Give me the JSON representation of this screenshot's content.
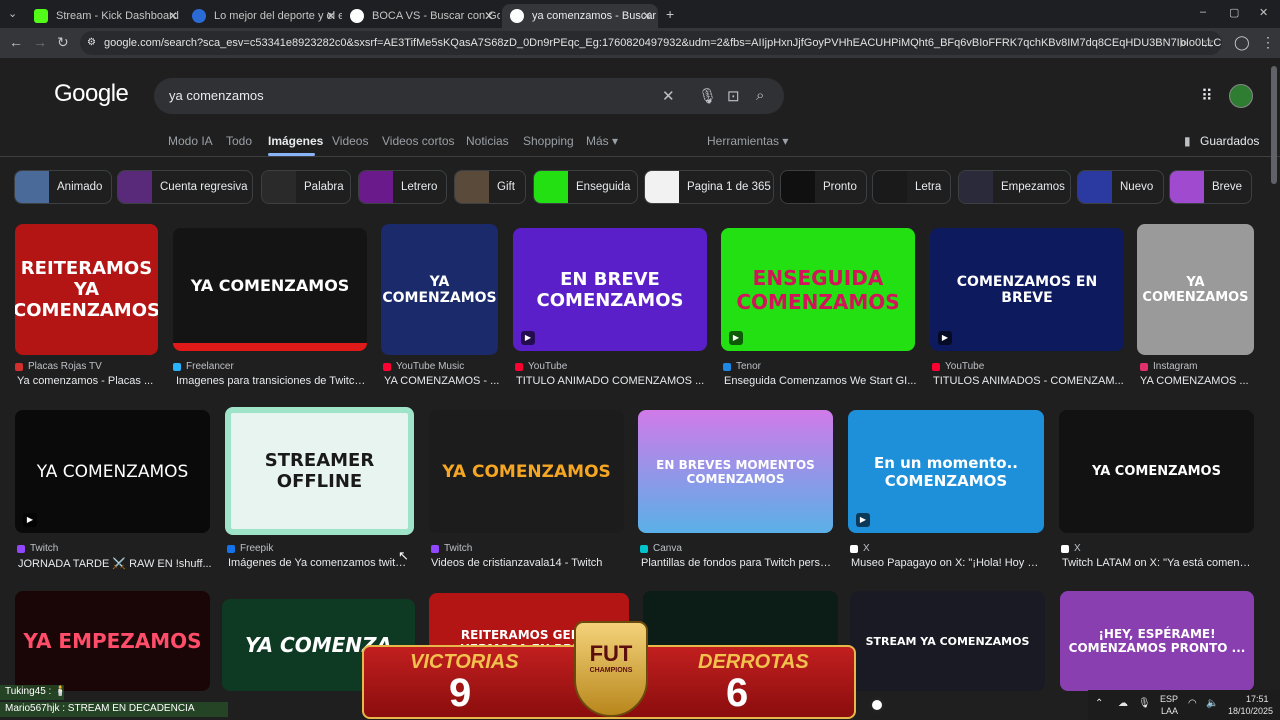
{
  "tabs": [
    {
      "title": "Stream - Kick Dashboard",
      "favicon_color": "#53fc18"
    },
    {
      "title": "Lo mejor del deporte y el entre",
      "favicon_color": "#2b6bd6"
    },
    {
      "title": "BOCA VS - Buscar con Google",
      "favicon_color": "#ffffff"
    },
    {
      "title": "ya comenzamos - Buscar con G",
      "favicon_color": "#ffffff"
    }
  ],
  "address_bar": {
    "url": "google.com/search?sca_esv=c53341e8923282c0&sxsrf=AE3TifMe5sKQasA7S68zD_0Dn9rPEqc_Eg:1760820497932&udm=2&fbs=AIIjpHxnJjfGoyPVHhEACUHPiMQht6_BFq6vBIoFFRK7qchKBv8IM7dq8CEqHDU3BN7IbIo0LLC9Cn6mkAPuJ2pf_5AB2jIEfeNRohPjG..."
  },
  "search": {
    "logo": "Google",
    "query": "ya comenzamos"
  },
  "nav": {
    "tabs": [
      "Modo IA",
      "Todo",
      "Imágenes",
      "Videos",
      "Videos cortos",
      "Noticias",
      "Shopping",
      "Más ▾"
    ],
    "active": "Imágenes",
    "tools": "Herramientas ▾",
    "saved": "Guardados"
  },
  "chips": [
    "Animado",
    "Cuenta regresiva",
    "Palabra",
    "Letrero",
    "Gift",
    "Enseguida",
    "Pagina 1 de 365",
    "Pronto",
    "Letra",
    "Empezamos",
    "Nuevo",
    "Breve"
  ],
  "row1": [
    {
      "img_text": "REITERAMOS YA COMENZAMOS",
      "source": "Placas Rojas TV",
      "caption": "Ya comenzamos - Placas ...",
      "bg": "#b31414",
      "fg": "#ffffff",
      "src_color": "#d32f2f"
    },
    {
      "img_text": "YA COMENZAMOS",
      "source": "Freelancer",
      "caption": "Imagenes para transiciones de Twitch ...",
      "bg": "#141414",
      "fg": "#ffffff",
      "src_color": "#29b2fe"
    },
    {
      "img_text": "YA COMENZAMOS",
      "source": "YouTube Music",
      "caption": "YA COMENZAMOS - ...",
      "bg": "#1a2a6b",
      "fg": "#ffffff",
      "src_color": "#ff0033"
    },
    {
      "img_text": "EN BREVE COMENZAMOS",
      "source": "YouTube",
      "caption": "TITULO ANIMADO COMENZAMOS ...",
      "bg": "#5a1fc9",
      "fg": "#ffffff",
      "src_color": "#ff0033"
    },
    {
      "img_text": "ENSEGUIDA COMENZAMOS",
      "source": "Tenor",
      "caption": "Enseguida Comenzamos We Start GI...",
      "bg": "#22e012",
      "fg": "#d4145a",
      "src_color": "#1e88e5"
    },
    {
      "img_text": "COMENZAMOS EN BREVE",
      "source": "YouTube",
      "caption": "TITULOS ANIMADOS - COMENZAM...",
      "bg": "#0d1a5e",
      "fg": "#ffffff",
      "src_color": "#ff0033"
    },
    {
      "img_text": "YA COMENZAMOS",
      "source": "Instagram",
      "caption": "YA COMENZAMOS ...",
      "bg": "#9a9a9a",
      "fg": "#ffffff",
      "src_color": "#e1306c"
    }
  ],
  "row2": [
    {
      "img_text": "YA COMENZAMOS",
      "source": "Twitch",
      "caption": "JORNADA TARDE ⚔️ RAW EN !shuff...",
      "bg": "#0a0a0a",
      "fg": "#ffffff",
      "src_color": "#9146ff"
    },
    {
      "img_text": "STREAMER OFFLINE",
      "source": "Freepik",
      "caption": "Imágenes de Ya comenzamos twitch ...",
      "bg": "#e8f4f0",
      "fg": "#1a1a1a",
      "src_color": "#1273eb"
    },
    {
      "img_text": "YA COMENZAMOS",
      "source": "Twitch",
      "caption": "Videos de cristianzavala14 - Twitch",
      "bg": "#1c1c1c",
      "fg": "#f5a623",
      "src_color": "#9146ff"
    },
    {
      "img_text": "EN BREVES MOMENTOS COMENZAMOS",
      "source": "Canva",
      "caption": "Plantillas de fondos para Twitch perso...",
      "bg": "#b85ed6",
      "fg": "#ffffff",
      "src_color": "#00c4cc"
    },
    {
      "img_text": "En un momento.. COMENZAMOS",
      "source": "X",
      "caption": "Museo Papagayo on X: \"¡Hola! Hoy e...",
      "bg": "#1e8fd9",
      "fg": "#ffffff",
      "src_color": "#ffffff"
    },
    {
      "img_text": "YA COMENZAMOS",
      "source": "X",
      "caption": "Twitch LATAM on X: \"Ya está comenz...",
      "bg": "#121212",
      "fg": "#ffffff",
      "src_color": "#ffffff"
    }
  ],
  "row3": [
    {
      "img_text": "YA EMPEZAMOS",
      "bg": "#1a0606",
      "fg": "#ff4d6a"
    },
    {
      "img_text": "YA COMENZA",
      "bg": "#0e3a24",
      "fg": "#ffffff"
    },
    {
      "img_text": "REITERAMOS GENTE HERMOSA EN BREVE",
      "bg": "#b31414",
      "fg": "#ffffff"
    },
    {
      "img_text": "",
      "bg": "#0c1c16",
      "fg": "#ffffff"
    },
    {
      "img_text": "STREAM YA COMENZAMOS",
      "bg": "#1a1a24",
      "fg": "#ffffff"
    },
    {
      "img_text": "¡HEY, ESPÉRAME! COMENZAMOS PRONTO ...",
      "bg": "#8a3fb0",
      "fg": "#ffffff"
    }
  ],
  "overlay": {
    "left_label": "VICTORIAS",
    "left_value": "9",
    "right_label": "DERROTAS",
    "right_value": "6",
    "badge": "FUT",
    "badge_sub": "CHAMPIONS"
  },
  "chat": [
    "Tuking45 : 🕯️",
    "Mario567hjk : STREAM EN DECADENCIA"
  ],
  "tray": {
    "lang": "ESP",
    "layout": "LAA",
    "time": "17:51",
    "date": "18/10/2025"
  }
}
